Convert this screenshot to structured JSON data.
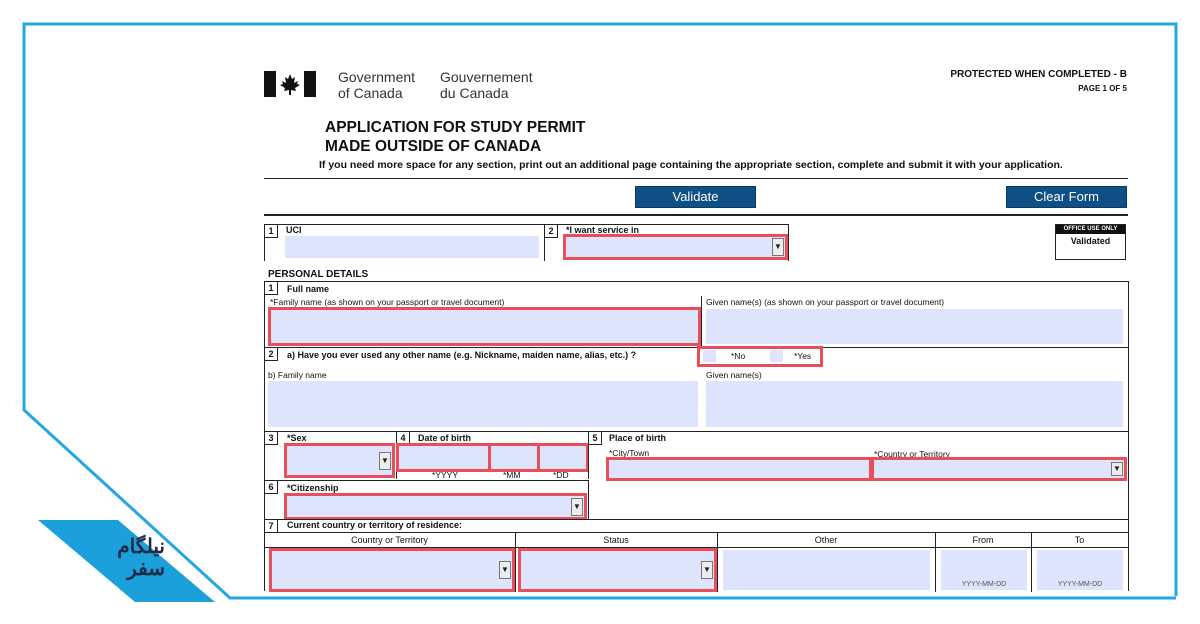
{
  "header": {
    "gov_en_line1": "Government",
    "gov_en_line2": "of Canada",
    "gov_fr_line1": "Gouvernement",
    "gov_fr_line2": "du Canada",
    "protected": "PROTECTED WHEN COMPLETED - B",
    "page": "PAGE 1 OF 5"
  },
  "title": {
    "line1": "APPLICATION FOR STUDY PERMIT",
    "line2": "MADE OUTSIDE OF CANADA",
    "note": "If you need more space for any section, print out an additional page containing the appropriate section, complete and submit it with your application."
  },
  "buttons": {
    "validate": "Validate",
    "clear": "Clear Form"
  },
  "top_section": {
    "uci_num": "1",
    "uci_label": "UCI",
    "service_num": "2",
    "service_label": "*I want service in",
    "office_use": "OFFICE USE ONLY",
    "office_value": "Validated"
  },
  "personal": {
    "heading": "PERSONAL DETAILS",
    "q1_num": "1",
    "q1_label": "Full name",
    "family_label": "*Family name (as shown on your passport or travel document)",
    "given_label": "Given name(s) (as shown on your passport or travel document)",
    "q2_num": "2",
    "q2_label": "a) Have you ever used any other name (e.g. Nickname, maiden name, alias, etc.) ?",
    "no_label": "*No",
    "yes_label": "*Yes",
    "b_family_label": "b) Family name",
    "b_given_label": "Given name(s)",
    "q3_num": "3",
    "sex_label": "*Sex",
    "q4_num": "4",
    "dob_label": "Date of birth",
    "yyyy": "*YYYY",
    "mm": "*MM",
    "dd": "*DD",
    "q5_num": "5",
    "pob_label": "Place of birth",
    "city_label": "*City/Town",
    "country_label": "*Country or Territory",
    "q6_num": "6",
    "citizenship_label": "*Citizenship",
    "q7_num": "7",
    "residence_label": "Current country or territory of residence:",
    "col_country": "Country or Territory",
    "col_status": "Status",
    "col_other": "Other",
    "col_from": "From",
    "col_to": "To",
    "date_hint": "YYYY-MM-DD"
  },
  "watermark": {
    "line1": "نیلگام",
    "line2": "سفر"
  }
}
